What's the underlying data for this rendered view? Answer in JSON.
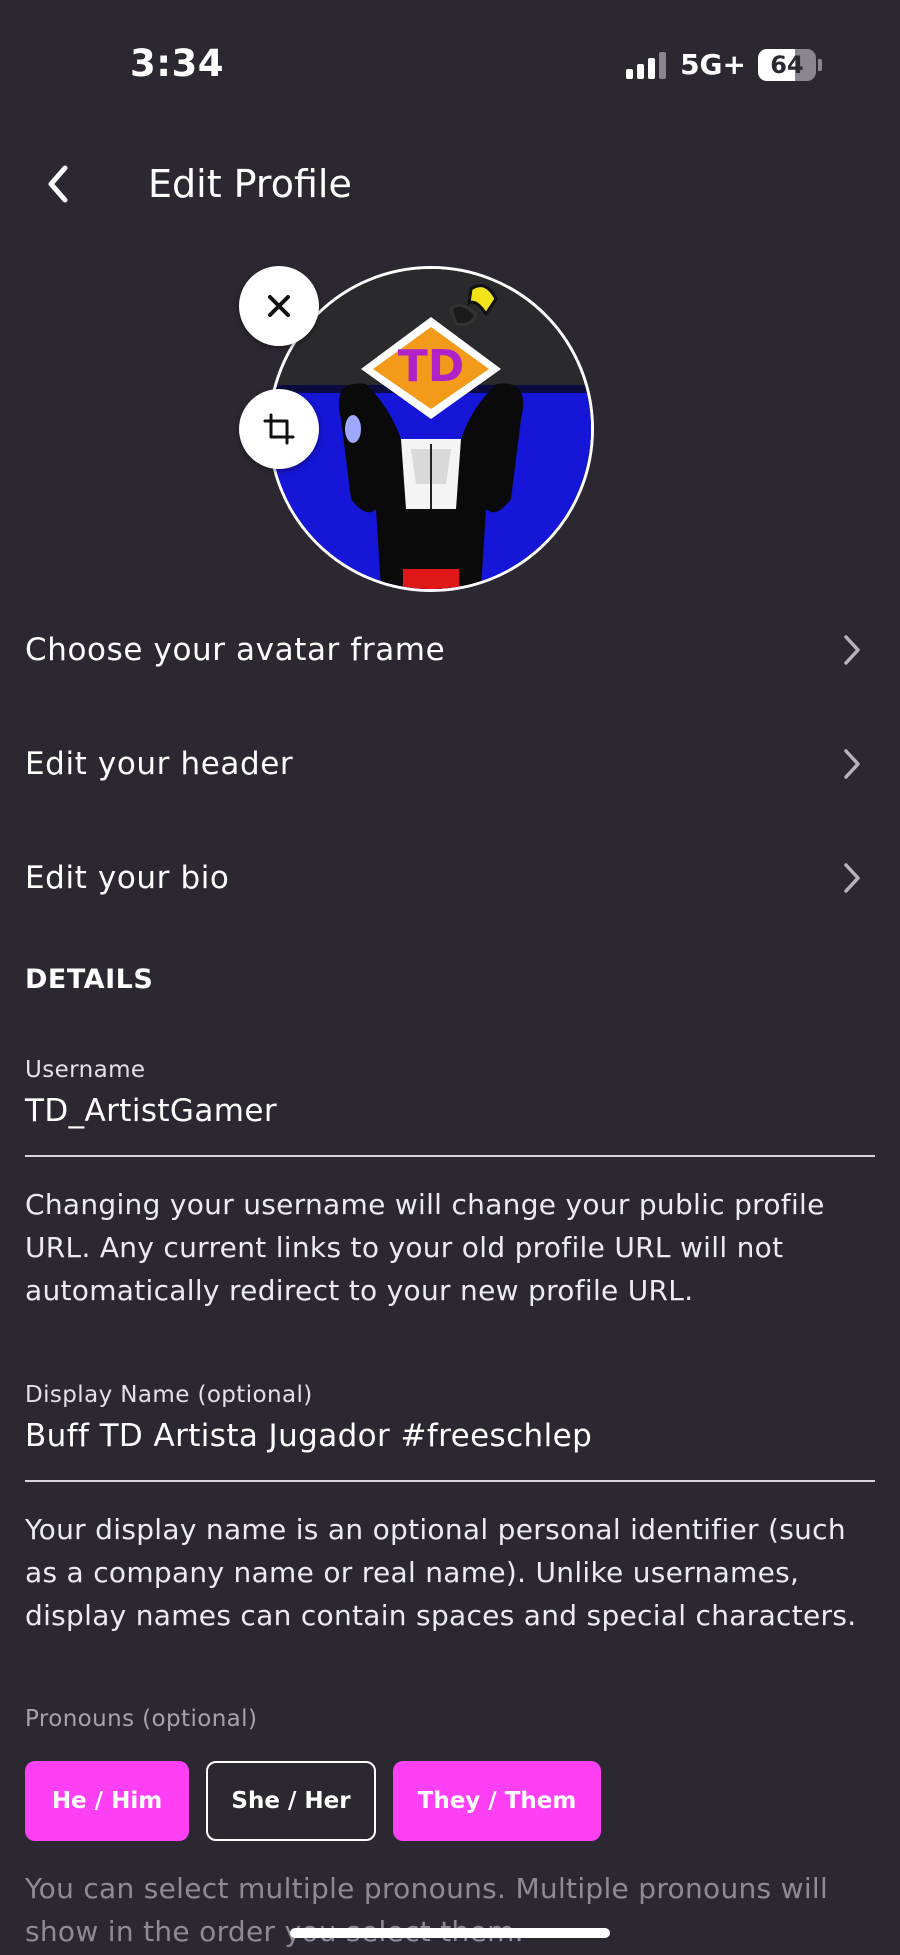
{
  "status_bar": {
    "time": "3:34",
    "network": "5G+",
    "battery": "64",
    "battery_level": 0.64
  },
  "header": {
    "title": "Edit Profile",
    "back_icon": "chevron-left-icon"
  },
  "avatar": {
    "remove_icon": "close-icon",
    "crop_icon": "crop-icon"
  },
  "menu": [
    {
      "label": "Choose your avatar frame"
    },
    {
      "label": "Edit your header"
    },
    {
      "label": "Edit your bio"
    }
  ],
  "details": {
    "title": "DETAILS",
    "username": {
      "label": "Username",
      "value": "TD_ArtistGamer",
      "help": "Changing your username will change your public profile URL. Any current links to your old profile URL will not automatically redirect to your new profile URL."
    },
    "display_name": {
      "label": "Display Name (optional)",
      "value": "Buff TD Artista Jugador #freeschlep",
      "help": "Your display name is an optional personal identifier (such as a company name or real name). Unlike usernames, display names can contain spaces and special characters."
    },
    "pronouns": {
      "label": "Pronouns (optional)",
      "options": [
        {
          "label": "He / Him",
          "selected": true
        },
        {
          "label": "She / Her",
          "selected": false
        },
        {
          "label": "They / Them",
          "selected": true
        }
      ],
      "help": "You can select multiple pronouns. Multiple pronouns will show in the order you select them."
    }
  },
  "colors": {
    "background": "#2c2832",
    "accent": "#ff3ff4",
    "text": "#ffffff",
    "muted": "#8f8b96"
  }
}
